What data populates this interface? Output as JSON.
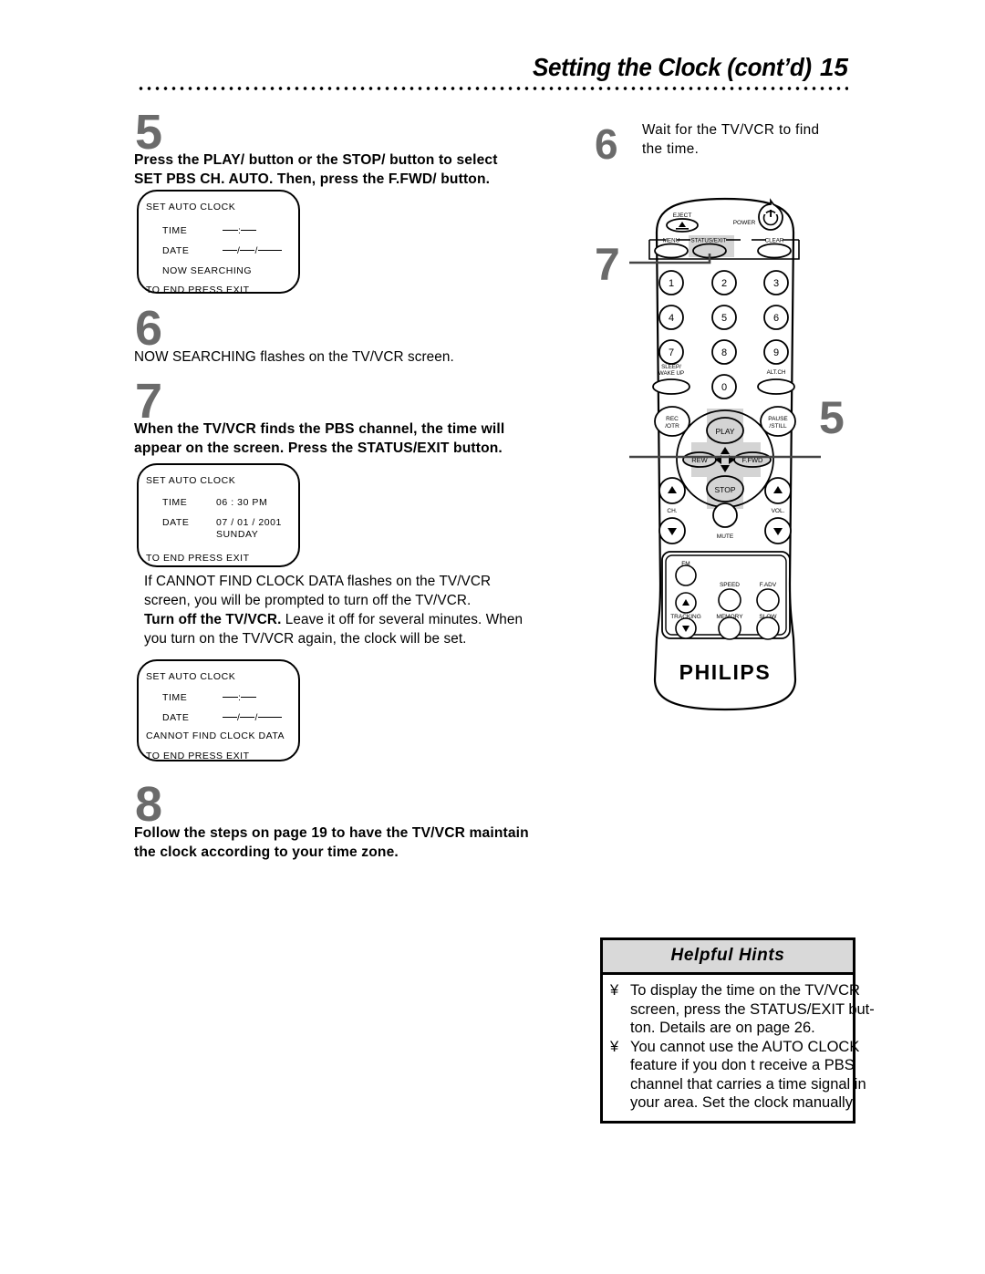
{
  "header": {
    "title": "Setting the Clock (cont’d)",
    "page_number": "15"
  },
  "steps": [
    {
      "number": "5",
      "lines": [
        "Press the PLAY/    button or the STOP/    button to select",
        "SET PBS CH. AUTO. Then, press the F.FWD/    button."
      ]
    },
    {
      "number": "6",
      "lines": [
        "NOW SEARCHING flashes on the TV/VCR screen."
      ]
    },
    {
      "number": "7",
      "lines": [
        "When the TV/VCR finds the PBS channel, the time will",
        "appear on the screen. Press the STATUS/EXIT button."
      ]
    },
    {
      "number": "8",
      "lines": [
        "Follow the steps on page 19 to have the TV/VCR maintain",
        "the clock according to your time zone."
      ]
    }
  ],
  "cannot_find_paragraph": {
    "line1": "If CANNOT FIND CLOCK DATA flashes on the TV/VCR",
    "line2": "screen, you will be prompted to turn off the TV/VCR.",
    "line3_bold": "Turn off the TV/VCR.",
    "line3_rest": " Leave it off for several minutes. When",
    "line4": "you turn on the TV/VCR again, the clock will be set."
  },
  "right_step": {
    "number": "6",
    "line1": "Wait for the TV/VCR to find",
    "line2": "the time."
  },
  "callouts": {
    "top": "7",
    "bottom": "5"
  },
  "osd_screens": [
    {
      "id": "osd-searching",
      "title": "SET AUTO CLOCK",
      "time_label": "TIME",
      "time_value": "",
      "date_label": "DATE",
      "date_value": "",
      "status": "NOW SEARCHING",
      "footer": "TO END PRESS EXIT"
    },
    {
      "id": "osd-found",
      "title": "SET AUTO CLOCK",
      "time_label": "TIME",
      "time_value": "06 : 30 PM",
      "date_label": "DATE",
      "date_value": "07 / 01 / 2001",
      "date_day": "SUNDAY",
      "footer": "TO END PRESS EXIT"
    },
    {
      "id": "osd-cannot-find",
      "title": "SET AUTO CLOCK",
      "time_label": "TIME",
      "time_value": "",
      "date_label": "DATE",
      "date_value": "",
      "status": "CANNOT FIND CLOCK DATA",
      "footer": "TO END PRESS EXIT"
    }
  ],
  "remote": {
    "brand": "PHILIPS",
    "buttons": {
      "eject": "EJECT",
      "power": "POWER",
      "menu": "MENU",
      "status_exit": "STATUS/EXIT",
      "clear": "CLEAR",
      "num_1": "1",
      "num_2": "2",
      "num_3": "3",
      "num_4": "4",
      "num_5": "5",
      "num_6": "6",
      "num_7": "7",
      "num_8": "8",
      "num_9": "9",
      "num_0": "0",
      "sleep_wake_up_1": "SLEEP/",
      "sleep_wake_up_2": "WAKE UP",
      "alt_ch": "ALT.CH",
      "rec_otr_1": "REC",
      "rec_otr_2": "/OTR",
      "pause_still_1": "PAUSE",
      "pause_still_2": "/STILL",
      "play": "PLAY",
      "stop": "STOP",
      "rew": "REW",
      "ffwd": "F.FWD",
      "ch": "CH.",
      "vol": "VOL.",
      "mute": "MUTE",
      "fm": "FM",
      "speed": "SPEED",
      "f_adv": "F.ADV",
      "tracking": "TRACKING",
      "memory": "MEMORY",
      "slow": "SLOW"
    }
  },
  "hints": {
    "title": "Helpful Hints",
    "bullet": "¥",
    "items": [
      [
        "To display the time on the TV/VCR",
        "screen, press the STATUS/EXIT but-",
        "ton. Details are on page 26."
      ],
      [
        "You cannot use the AUTO CLOCK",
        "feature if you don t receive a PBS",
        "channel that carries a time signal in",
        "your area. Set the clock manually."
      ]
    ]
  },
  "colors": {
    "step_number": "#6b6b6b",
    "hints_header_bg": "#d9d9d9",
    "highlight": "#d4d4d4"
  }
}
